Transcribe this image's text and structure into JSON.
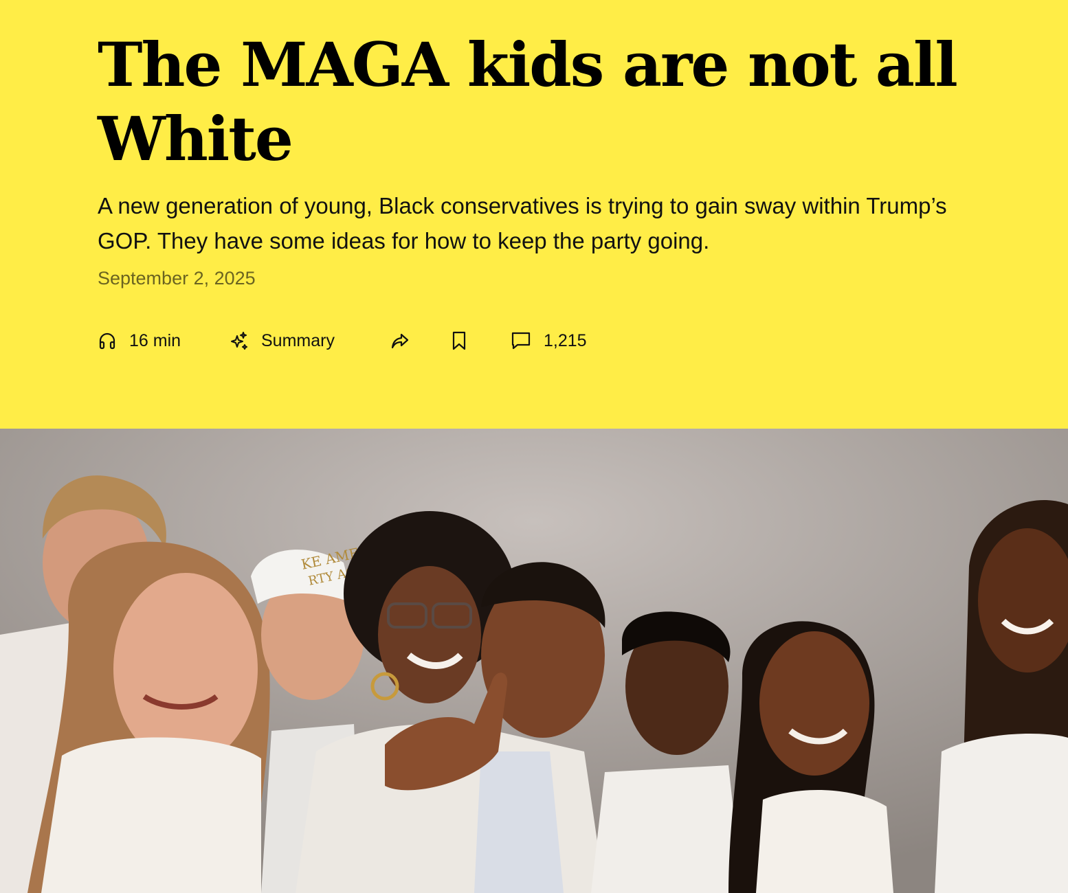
{
  "article": {
    "headline": "The MAGA kids are not all White",
    "dek": "A new generation of young, Black conservatives is trying to gain sway within Trump’s GOP. They have some ideas for how to keep the party going.",
    "date": "September 2, 2025"
  },
  "toolbar": {
    "listen": {
      "label": "16 min",
      "icon": "headphones-icon"
    },
    "summary": {
      "label": "Summary",
      "icon": "sparkle-icon"
    },
    "share": {
      "icon": "share-icon"
    },
    "save": {
      "icon": "bookmark-icon"
    },
    "comments": {
      "label": "1,215",
      "icon": "comment-icon"
    }
  },
  "hero_image": {
    "hat_text_line1": "KE AMERICA",
    "hat_text_line2": "RTY AGAI"
  },
  "colors": {
    "header_background": "#ffed47",
    "headline": "#000000",
    "date": "#6b6420"
  }
}
